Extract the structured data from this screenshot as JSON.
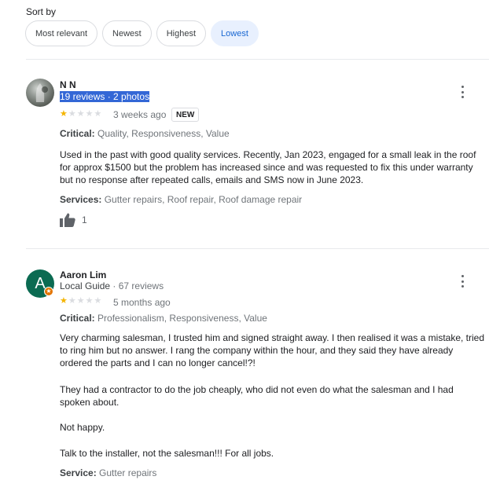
{
  "sort": {
    "label": "Sort by",
    "options": [
      "Most relevant",
      "Newest",
      "Highest",
      "Lowest"
    ],
    "selected": "Lowest"
  },
  "reviews": [
    {
      "author": "N N",
      "stats_reviews": "19 reviews",
      "stats_sep": " · ",
      "stats_photos": "2 photos",
      "rating": 1,
      "max_rating": 5,
      "time": "3 weeks ago",
      "badge": "NEW",
      "critical_label": "Critical:",
      "critical_value": "Quality, Responsiveness, Value",
      "text": [
        "Used in the past with good quality services. Recently, Jan 2023, engaged for a small leak in the roof for approx $1500 but the problem has increased  since and was requested to fix this under warranty but no response after repeated calls, emails and SMS now in June 2023."
      ],
      "services_label": "Services:",
      "services_value": "Gutter repairs, Roof repair, Roof damage repair",
      "likes": "1"
    },
    {
      "author": "Aaron Lim",
      "avatar_letter": "A",
      "guide": "Local Guide",
      "stats_sep": " · ",
      "stats_reviews": "67 reviews",
      "rating": 1,
      "max_rating": 5,
      "time": "5 months ago",
      "critical_label": "Critical:",
      "critical_value": "Professionalism, Responsiveness, Value",
      "text": [
        "Very charming salesman, I trusted him and signed straight away. I then realised it was a mistake, tried to ring him but no answer. I rang the company within the hour, and they said they have already ordered the parts and I can no longer cancel!?!",
        "They had a contractor to do the job cheaply, who did not even do what the salesman and I had spoken about.",
        "Not happy.",
        "Talk to the installer, not the salesman!!! For all jobs."
      ],
      "services_label": "Service:",
      "services_value": "Gutter repairs"
    }
  ],
  "colors": {
    "accent": "#1967d2",
    "star": "#f4b400",
    "avatar_green": "#0b6b52",
    "highlight": "#3367d6"
  }
}
